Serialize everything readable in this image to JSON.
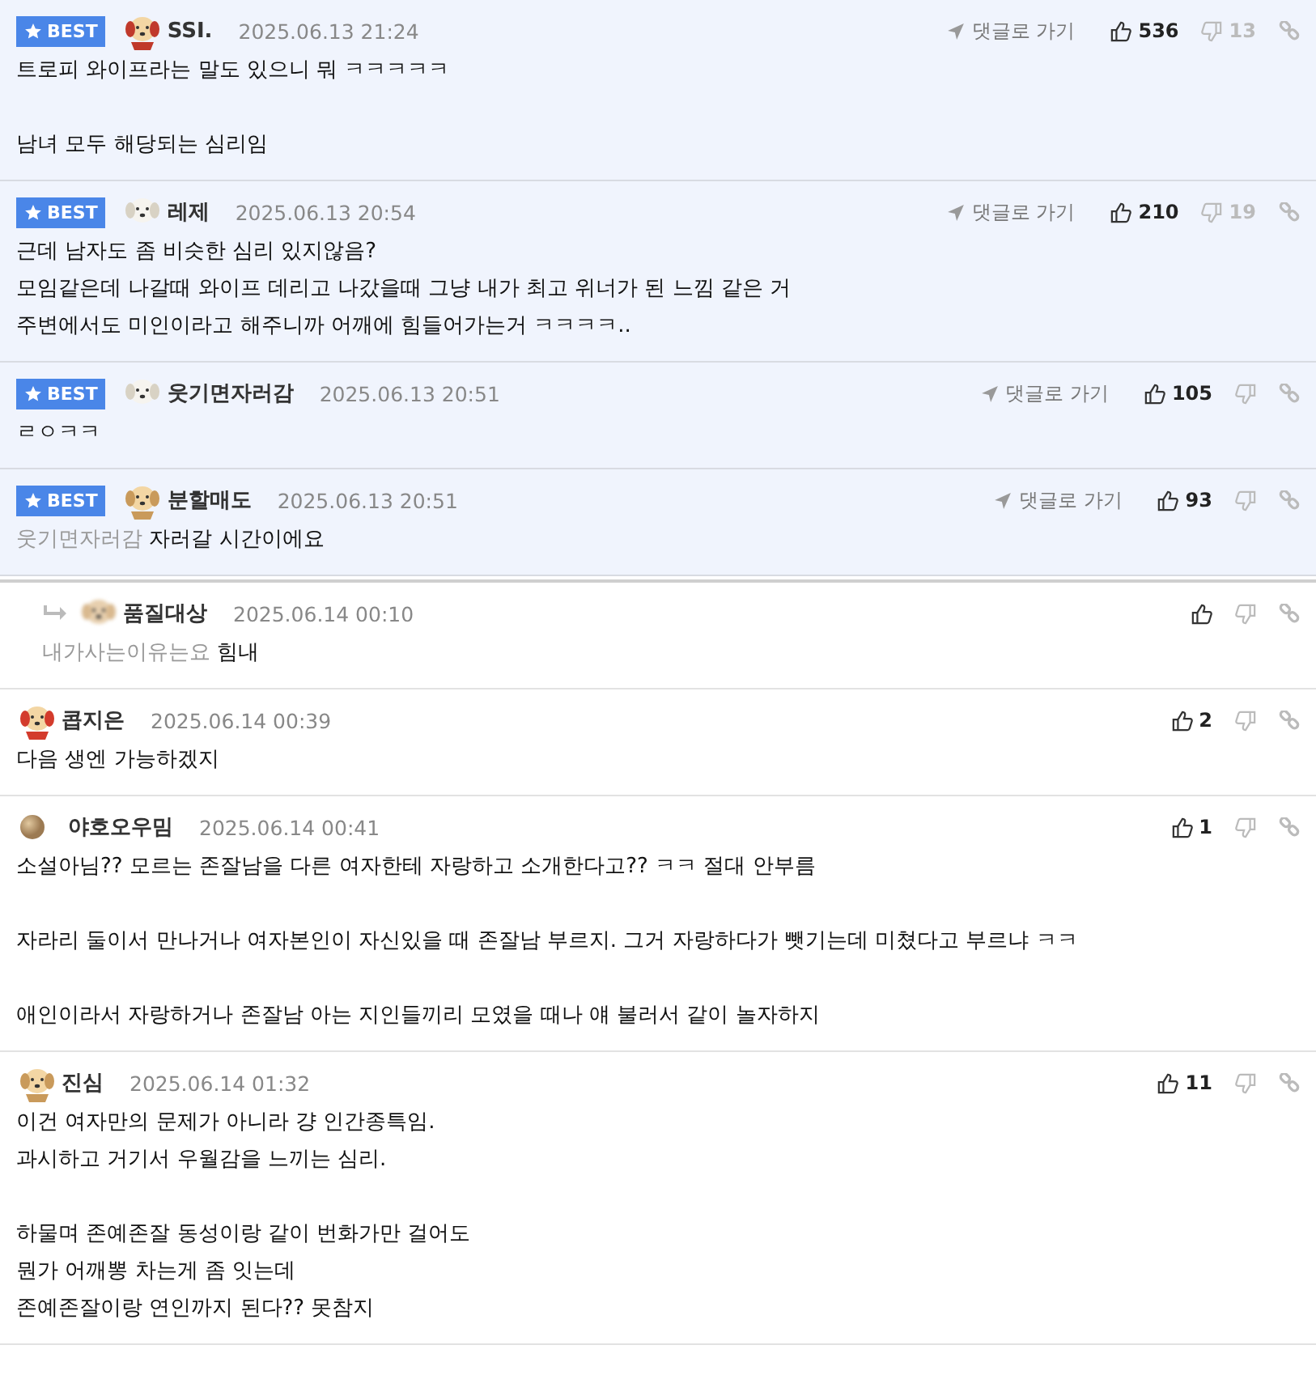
{
  "comments": [
    {
      "best": true,
      "reply": false,
      "badge": "BEST",
      "avatar": {
        "kind": "puppy-cape"
      },
      "author": "SSI.",
      "date": "2025.06.13 21:24",
      "goto": "댓글로 가기",
      "likes": "536",
      "dislikes": "13",
      "paragraphs": [
        [
          "트로피 와이프라는 말도 있으니 뭐 ㅋㅋㅋㅋㅋ"
        ],
        [
          "남녀 모두 해당되는 심리임"
        ]
      ]
    },
    {
      "best": true,
      "reply": false,
      "badge": "BEST",
      "avatar": {
        "kind": "white-dog"
      },
      "author": "레제",
      "date": "2025.06.13 20:54",
      "goto": "댓글로 가기",
      "likes": "210",
      "dislikes": "19",
      "paragraphs": [
        [
          "근데 남자도 좀 비슷한 심리 있지않음?",
          "모임같은데 나갈때 와이프 데리고 나갔을때 그냥 내가 최고 위너가 된 느낌 같은 거",
          "주변에서도 미인이라고 해주니까 어깨에 힘들어가는거 ㅋㅋㅋㅋ.."
        ]
      ]
    },
    {
      "best": true,
      "reply": false,
      "badge": "BEST",
      "avatar": {
        "kind": "white-dog"
      },
      "author": "웃기면자러감",
      "date": "2025.06.13 20:51",
      "goto": "댓글로 가기",
      "likes": "105",
      "paragraphs": [
        [
          "ㄹㅇㅋㅋ"
        ]
      ]
    },
    {
      "best": true,
      "reply": false,
      "badge": "BEST",
      "avatar": {
        "kind": "puppy"
      },
      "author": "분할매도",
      "date": "2025.06.13 20:51",
      "goto": "댓글로 가기",
      "likes": "93",
      "mention": "웃기면자러감",
      "paragraphs": [
        [
          "자러갈 시간이에요"
        ]
      ]
    },
    {
      "best": false,
      "reply": true,
      "avatar": {
        "kind": "blurred"
      },
      "author": "품질대상",
      "date": "2025.06.14 00:10",
      "mention": "내가사는이유는요",
      "paragraphs": [
        [
          "힘내"
        ]
      ]
    },
    {
      "best": false,
      "reply": false,
      "avatar": {
        "kind": "puppy-hood"
      },
      "author": "콥지은",
      "date": "2025.06.14 00:39",
      "likes": "2",
      "paragraphs": [
        [
          "다음 생엔 가능하겠지"
        ]
      ]
    },
    {
      "best": false,
      "reply": false,
      "avatar": {
        "kind": "ball"
      },
      "author": "야호오우밈",
      "date": "2025.06.14 00:41",
      "likes": "1",
      "paragraphs": [
        [
          "소설아님?? 모르는 존잘남을 다른 여자한테 자랑하고 소개한다고?? ㅋㅋ 절대 안부름"
        ],
        [
          "자라리 둘이서 만나거나 여자본인이 자신있을 때 존잘남 부르지. 그거 자랑하다가 뺏기는데 미쳤다고 부르냐 ㅋㅋ"
        ],
        [
          "애인이라서 자랑하거나 존잘남 아는 지인들끼리 모였을 때나 얘 불러서 같이 놀자하지"
        ]
      ]
    },
    {
      "best": false,
      "reply": false,
      "avatar": {
        "kind": "puppy"
      },
      "author": "진심",
      "date": "2025.06.14 01:32",
      "likes": "11",
      "paragraphs": [
        [
          "이건 여자만의 문제가 아니라 걍 인간종특임.",
          "과시하고 거기서 우월감을 느끼는 심리."
        ],
        [
          "하물며 존예존잘 동성이랑 같이 번화가만 걸어도",
          "뭔가 어깨뽕 차는게 좀 잇는데",
          "존예존잘이랑 연인까지 된다?? 못참지"
        ]
      ]
    }
  ]
}
